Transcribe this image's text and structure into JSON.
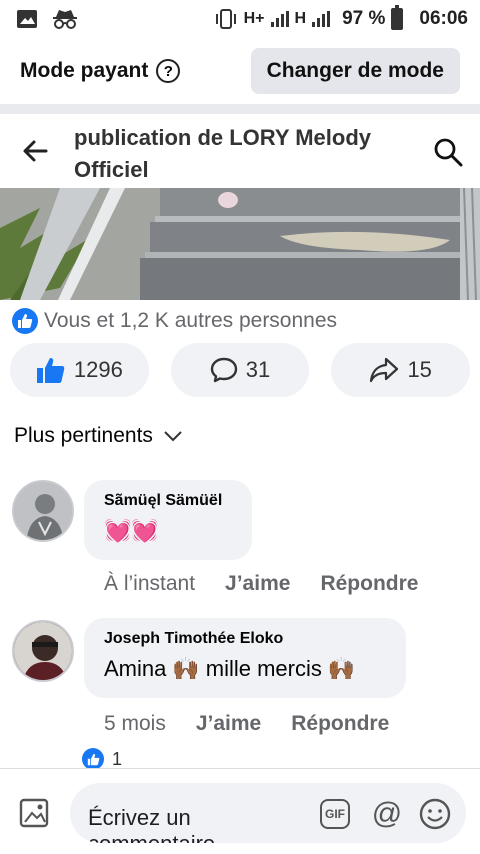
{
  "status_bar": {
    "left_icons": [
      "image-icon",
      "incognito-icon"
    ],
    "network_1": "H+",
    "network_2": "H",
    "battery": "97 %",
    "time": "06:06"
  },
  "mode_bar": {
    "label": "Mode payant",
    "help": "?",
    "change_button": "Changer de mode"
  },
  "header": {
    "title": "publication de LORY Melody Officiel"
  },
  "reactions": {
    "summary": "Vous et 1,2 K autres personnes"
  },
  "actions": {
    "likes": "1296",
    "comments": "31",
    "shares": "15"
  },
  "sort": {
    "label": "Plus pertinents"
  },
  "comments": [
    {
      "author": "Sãmüęl Sämüël",
      "text": "💓💓",
      "time": "À l’instant",
      "like": "J’aime",
      "reply": "Répondre"
    },
    {
      "author": "Joseph Timothée Eloko",
      "text_1": "Amina",
      "emoji_1": "🙌🏾",
      "text_2": "mille mercis",
      "emoji_2": "🙌🏾",
      "time": "5 mois",
      "like": "J’aime",
      "reply": "Répondre",
      "reaction_count": "1"
    }
  ],
  "composer": {
    "placeholder": "Écrivez un commentaire",
    "gif": "GIF",
    "at": "@"
  },
  "colors": {
    "accent": "#1877f2",
    "bubble": "#f0f2f5",
    "muted": "#65676b"
  }
}
